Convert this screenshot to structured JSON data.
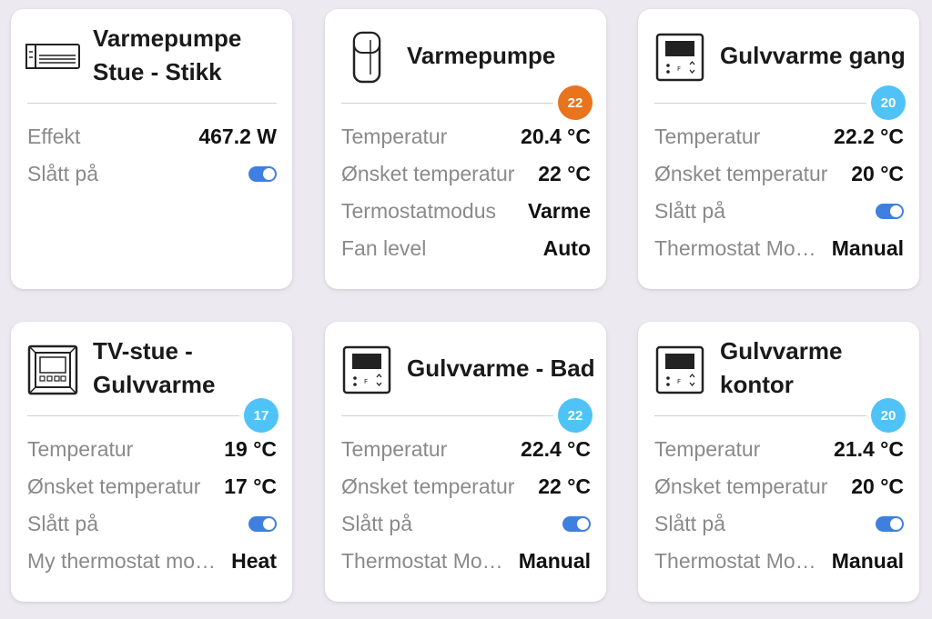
{
  "cards": [
    {
      "title": "Varmepumpe Stue - Stikk",
      "icon": "air-conditioner-icon",
      "rows": [
        {
          "label": "Effekt",
          "value": "467.2 W"
        },
        {
          "label": "Slått på",
          "toggle": true
        }
      ]
    },
    {
      "title": "Varmepumpe",
      "icon": "heat-pump-remote-icon",
      "badge": "22",
      "badge_color": "#e8741e",
      "rows": [
        {
          "label": "Temperatur",
          "value": "20.4 °C"
        },
        {
          "label": "Ønsket temperatur",
          "value": "22 °C"
        },
        {
          "label": "Termostatmodus",
          "value": "Varme"
        },
        {
          "label": "Fan level",
          "value": "Auto"
        }
      ]
    },
    {
      "title": "Gulvvarme gang",
      "icon": "thermostat-icon",
      "badge": "20",
      "badge_color": "#4fc3f7",
      "rows": [
        {
          "label": "Temperatur",
          "value": "22.2 °C"
        },
        {
          "label": "Ønsket temperatur",
          "value": "20 °C"
        },
        {
          "label": "Slått på",
          "toggle": true
        },
        {
          "label": "Thermostat Mo…",
          "value": "Manual"
        }
      ]
    },
    {
      "title": "TV-stue - Gulvvarme",
      "icon": "floor-thermostat-icon",
      "badge": "17",
      "badge_color": "#4fc3f7",
      "rows": [
        {
          "label": "Temperatur",
          "value": "19 °C"
        },
        {
          "label": "Ønsket temperatur",
          "value": "17 °C"
        },
        {
          "label": "Slått på",
          "toggle": true
        },
        {
          "label": "My thermostat mo…",
          "value": "Heat"
        }
      ]
    },
    {
      "title": "Gulvvarme - Bad",
      "icon": "thermostat-icon",
      "badge": "22",
      "badge_color": "#4fc3f7",
      "rows": [
        {
          "label": "Temperatur",
          "value": "22.4 °C"
        },
        {
          "label": "Ønsket temperatur",
          "value": "22 °C"
        },
        {
          "label": "Slått på",
          "toggle": true
        },
        {
          "label": "Thermostat Mo…",
          "value": "Manual"
        }
      ]
    },
    {
      "title": "Gulvvarme kontor",
      "icon": "thermostat-icon",
      "badge": "20",
      "badge_color": "#4fc3f7",
      "rows": [
        {
          "label": "Temperatur",
          "value": "21.4 °C"
        },
        {
          "label": "Ønsket temperatur",
          "value": "20 °C"
        },
        {
          "label": "Slått på",
          "toggle": true
        },
        {
          "label": "Thermostat Mo…",
          "value": "Manual"
        }
      ]
    }
  ]
}
